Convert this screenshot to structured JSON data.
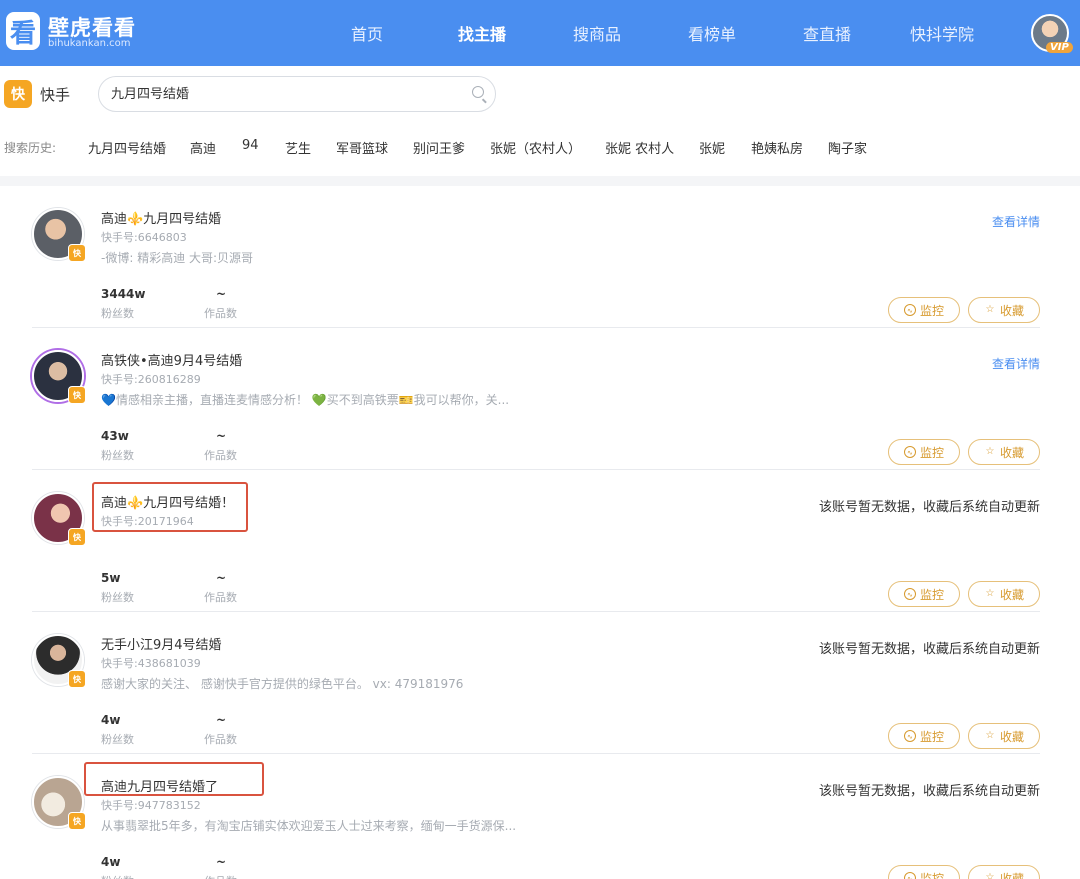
{
  "header": {
    "logo_char": "看",
    "logo_name": "壁虎看看",
    "logo_domain": "bihukankan.com",
    "nav": [
      "首页",
      "找主播",
      "搜商品",
      "看榜单",
      "查直播",
      "快抖学院"
    ],
    "active_nav": "找主播",
    "vip": "VIP"
  },
  "search": {
    "platform_label": "快手",
    "platform_icon_text": "快",
    "query": "九月四号结婚",
    "history_label": "搜索历史:",
    "history": [
      "九月四号结婚",
      "高迪",
      "94",
      "艺生",
      "军哥篮球",
      "别问王爹",
      "张妮（农村人）",
      "张妮 农村人",
      "张妮",
      "艳姨私房",
      "陶子家"
    ]
  },
  "labels": {
    "fans": "粉丝数",
    "works": "作品数",
    "detail": "查看详情",
    "nodata": "该账号暂无数据，收藏后系统自动更新",
    "monitor": "监控",
    "collect": "收藏"
  },
  "results": [
    {
      "name": "高迪⚜️九月四号结婚",
      "id": "快手号:6646803",
      "desc": "-微博: 精彩高迪 大哥:贝源哥",
      "fans": "3444w",
      "works": "~",
      "status": "detail"
    },
    {
      "name": "高铁侠•高迪9月4号结婚",
      "id": "快手号:260816289",
      "desc": "💙情感相亲主播，直播连麦情感分析！ 💚买不到高铁票🎫我可以帮你，关...",
      "fans": "43w",
      "works": "~",
      "status": "detail"
    },
    {
      "name": "高迪⚜️九月四号结婚！",
      "id": "快手号:20171964",
      "desc": "",
      "fans": "5w",
      "works": "~",
      "status": "nodata"
    },
    {
      "name": "无手小江9月4号结婚",
      "id": "快手号:438681039",
      "desc": "感谢大家的关注、 感谢快手官方提供的绿色平台。 vx: 479181976",
      "fans": "4w",
      "works": "~",
      "status": "nodata"
    },
    {
      "name": "高迪九月四号结婚了",
      "id": "快手号:947783152",
      "desc": "从事翡翠批5年多，有淘宝店铺实体欢迎爱玉人士过来考察，缅甸一手货源保...",
      "fans": "4w",
      "works": "~",
      "status": "nodata"
    }
  ],
  "colors": {
    "header": "#4a8ef0",
    "accent": "#d79a2e",
    "link": "#4a8ef0",
    "highlight": "#d9533f"
  }
}
